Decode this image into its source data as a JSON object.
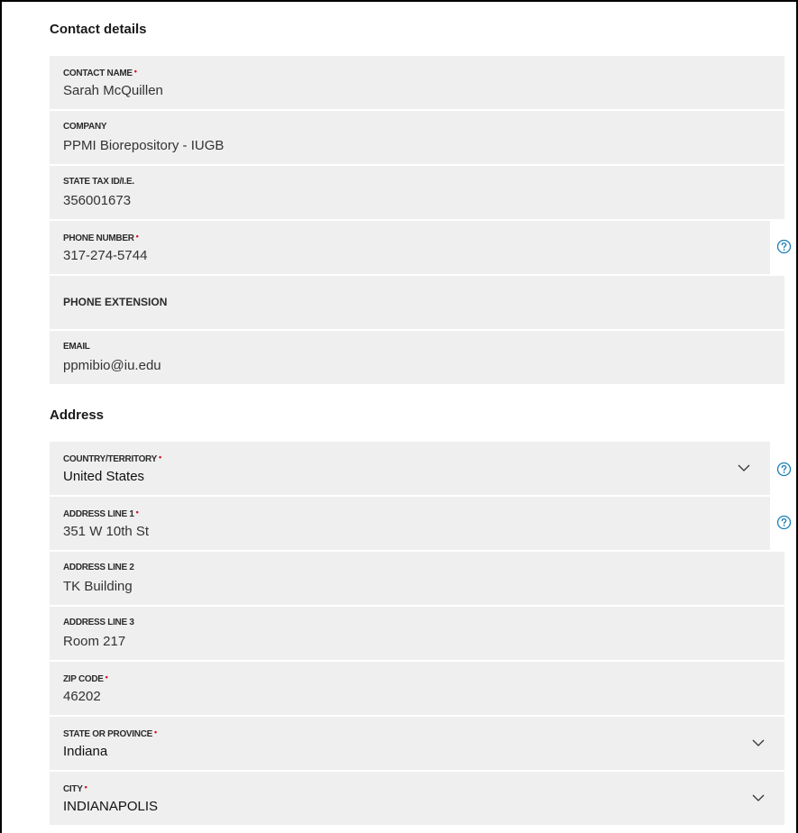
{
  "contact": {
    "title": "Contact details",
    "fields": [
      {
        "label": "CONTACT NAME",
        "value": "Sarah McQuillen",
        "required": true
      },
      {
        "label": "COMPANY",
        "value": "PPMI Biorepository - IUGB",
        "required": false
      },
      {
        "label": "STATE TAX ID/I.E.",
        "value": "356001673",
        "required": false
      },
      {
        "label": "PHONE NUMBER",
        "value": "317-274-5744",
        "required": true
      },
      {
        "label": "PHONE EXTENSION",
        "value": "",
        "required": false
      },
      {
        "label": "EMAIL",
        "value": "ppmibio@iu.edu",
        "required": false
      }
    ]
  },
  "address": {
    "title": "Address",
    "fields": [
      {
        "label": "COUNTRY/TERRITORY",
        "value": "United States",
        "required": true
      },
      {
        "label": "ADDRESS LINE 1",
        "value": "351 W 10th St",
        "required": true
      },
      {
        "label": "ADDRESS LINE 2",
        "value": "TK Building",
        "required": false
      },
      {
        "label": "ADDRESS LINE 3",
        "value": "Room 217",
        "required": false
      },
      {
        "label": "ZIP CODE",
        "value": "46202",
        "required": true
      },
      {
        "label": "STATE OR PROVINCE",
        "value": "Indiana",
        "required": true
      },
      {
        "label": "CITY",
        "value": "INDIANAPOLIS",
        "required": true
      }
    ]
  },
  "required_marker": "•",
  "icons": {
    "help": "help-circle-icon",
    "dropdown": "chevron-down-icon"
  },
  "colors": {
    "accent": "#1b7fb5",
    "required": "#d0102b",
    "field_bg": "#efefef"
  }
}
